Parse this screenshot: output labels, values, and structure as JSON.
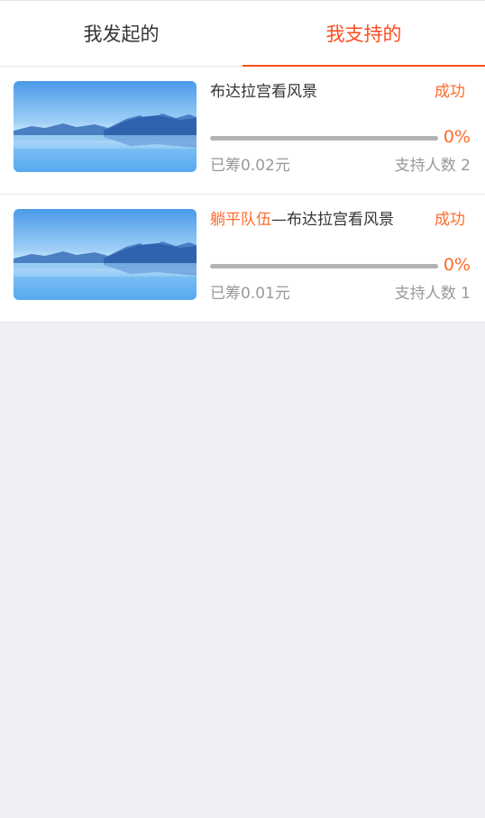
{
  "tabs": [
    {
      "label": "我发起的",
      "active": false
    },
    {
      "label": "我支持的",
      "active": true
    }
  ],
  "projects": [
    {
      "title_prefix": "",
      "title": "布达拉宫看风景",
      "status": "成功",
      "progress_percent": 0,
      "progress_label": "0%",
      "raised_label": "已筹0.02元",
      "supporters_label": "支持人数 2"
    },
    {
      "title_prefix": "躺平队伍",
      "title": "—布达拉宫看风景",
      "status": "成功",
      "progress_percent": 0,
      "progress_label": "0%",
      "raised_label": "已筹0.01元",
      "supporters_label": "支持人数 1"
    }
  ],
  "colors": {
    "accent": "#ff4c1f",
    "highlight": "#ff6a2c",
    "muted": "#999999"
  }
}
